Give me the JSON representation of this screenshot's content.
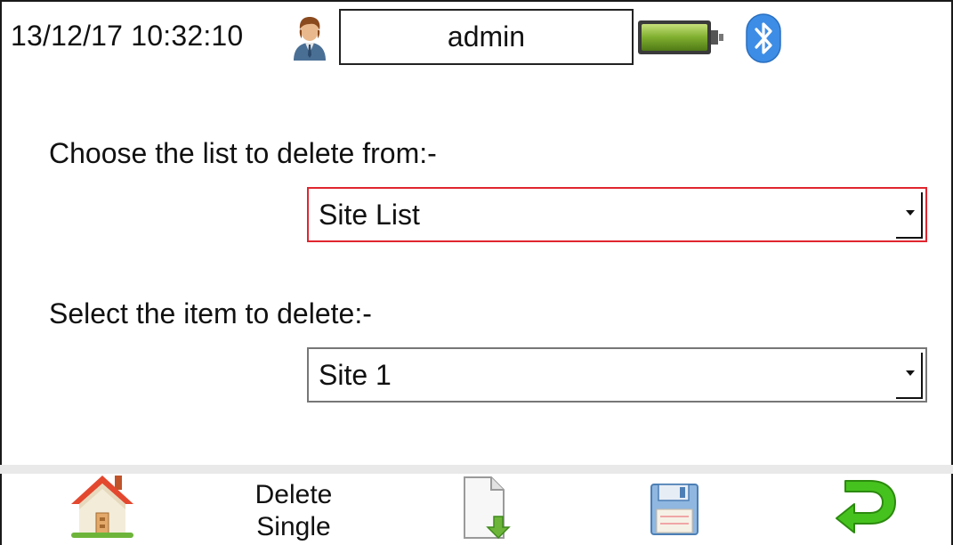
{
  "status": {
    "datetime": "13/12/17 10:32:10",
    "user_icon": "user-icon",
    "username": "admin",
    "battery_icon": "battery-full-icon",
    "bluetooth_icon": "bluetooth-icon",
    "battery_color": "#7fae2f",
    "bluetooth_color": "#3d8de6"
  },
  "form": {
    "list_label": "Choose the list to delete from:-",
    "list_value": "Site List",
    "item_label": "Select the item to delete:-",
    "item_value": "Site 1",
    "focus_color": "#e0262f"
  },
  "toolbar": {
    "home_icon": "home-icon",
    "delete_line1": "Delete",
    "delete_line2": "Single",
    "export_icon": "file-export-icon",
    "save_icon": "save-icon",
    "back_icon": "back-arrow-icon",
    "back_color": "#3dbd1c"
  }
}
